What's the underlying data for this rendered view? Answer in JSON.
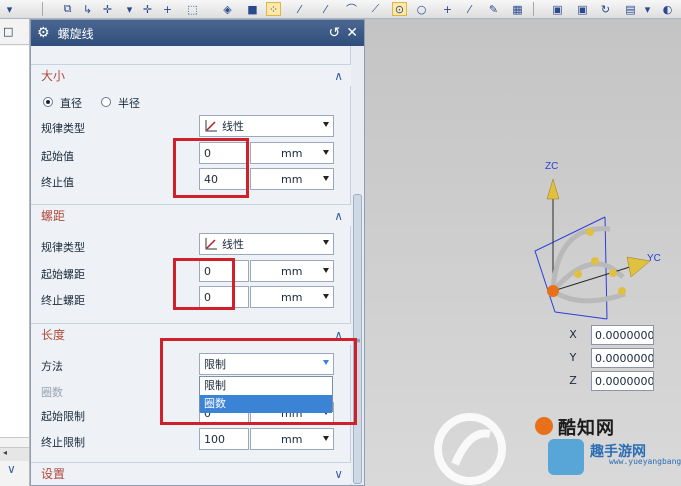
{
  "dialog": {
    "title": "螺旋线"
  },
  "size_section": {
    "header": "大小",
    "radio_diameter": "直径",
    "radio_radius": "半径",
    "law_type_label": "规律类型",
    "law_type_value": "线性",
    "start_label": "起始值",
    "start_value": "0",
    "end_label": "终止值",
    "end_value": "40",
    "unit": "mm"
  },
  "pitch_section": {
    "header": "螺距",
    "law_type_label": "规律类型",
    "law_type_value": "线性",
    "start_label": "起始螺距",
    "start_value": "0",
    "end_label": "终止螺距",
    "end_value": "0",
    "unit": "mm"
  },
  "length_section": {
    "header": "长度",
    "method_label": "方法",
    "method_value": "限制",
    "turns_label": "圈数",
    "dropdown_options": [
      "限制",
      "圈数"
    ],
    "start_limit_label": "起始限制",
    "start_limit_value": "0",
    "end_limit_label": "终止限制",
    "end_limit_value": "100",
    "unit": "mm"
  },
  "settings_section": {
    "header": "设置"
  },
  "coordinates": {
    "x_label": "X",
    "x_value": "0.0000000",
    "y_label": "Y",
    "y_value": "0.0000000",
    "z_label": "Z",
    "z_value": "0.0000000"
  },
  "triad_labels": {
    "z": "ZC",
    "y": "YC"
  },
  "watermark": {
    "brand": "酷知网",
    "site_cn": "趣手游网",
    "url": "www.yueyangbang.com"
  },
  "colors": {
    "title_bar": "#3b5a86",
    "section_header_text": "#b04a3a",
    "highlight_box": "#d0202a",
    "dropdown_selected": "#3b83d4"
  }
}
